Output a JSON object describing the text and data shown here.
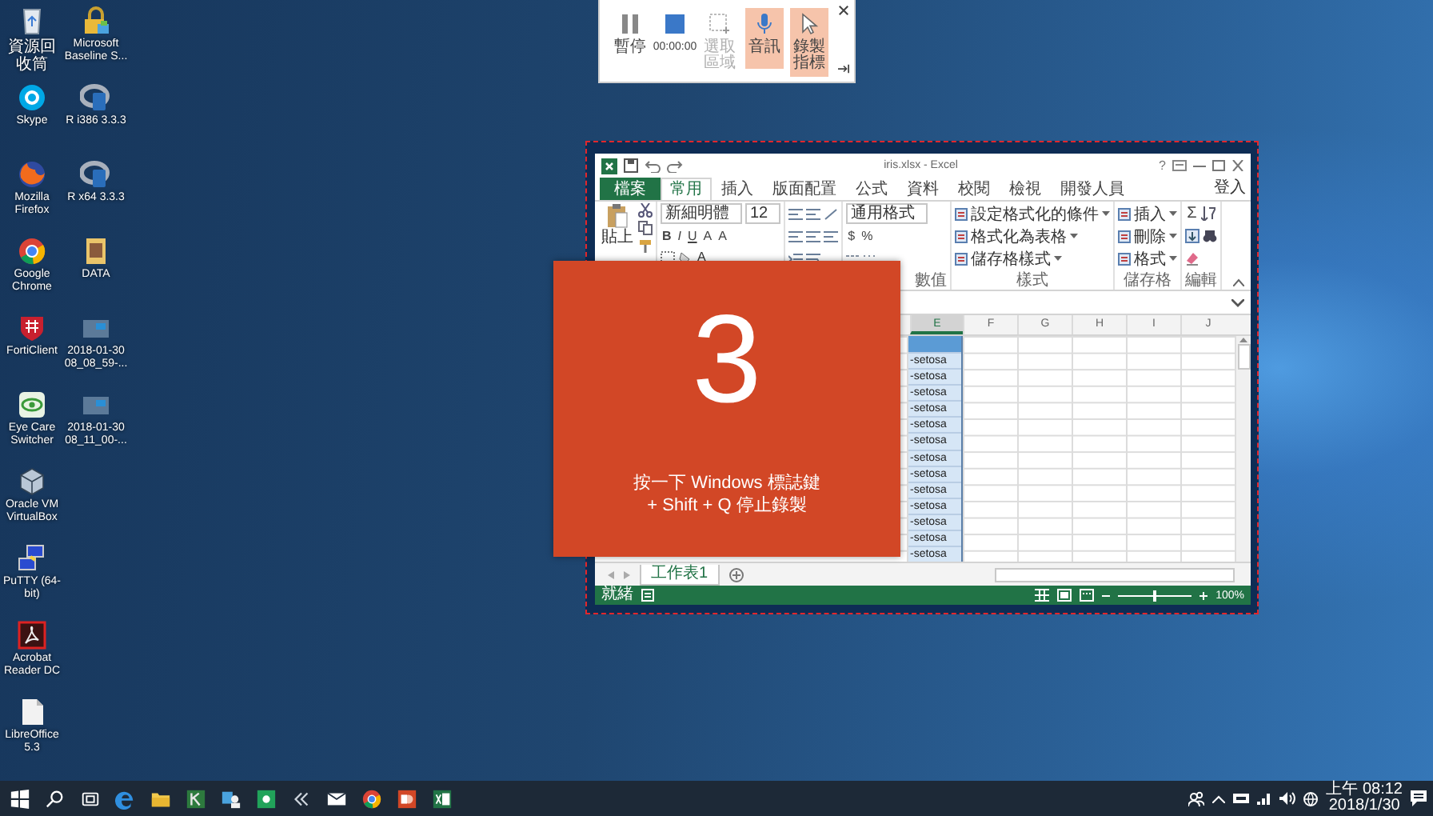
{
  "desktop_icons": [
    {
      "label": "資源回收筒",
      "kind": "recycle"
    },
    {
      "label": "Skype",
      "kind": "skype"
    },
    {
      "label": "Mozilla Firefox",
      "kind": "firefox"
    },
    {
      "label": "Google Chrome",
      "kind": "chrome"
    },
    {
      "label": "FortiClient",
      "kind": "forti"
    },
    {
      "label": "Eye Care Switcher",
      "kind": "eye"
    },
    {
      "label": "Oracle VM VirtualBox",
      "kind": "vbox"
    },
    {
      "label": "PuTTY (64-bit)",
      "kind": "putty"
    },
    {
      "label": "Acrobat Reader DC",
      "kind": "acrobat"
    },
    {
      "label": "LibreOffice 5.3",
      "kind": "doc"
    },
    {
      "label": "Microsoft Baseline S...",
      "kind": "lock"
    },
    {
      "label": "R i386 3.3.3",
      "kind": "r"
    },
    {
      "label": "R x64 3.3.3",
      "kind": "r"
    },
    {
      "label": "DATA",
      "kind": "folder"
    },
    {
      "label": "2018-01-30 08_08_59-...",
      "kind": "video"
    },
    {
      "label": "2018-01-30 08_11_00-...",
      "kind": "video"
    }
  ],
  "recorder": {
    "buttons": [
      {
        "kind": "pause",
        "label": "暫停",
        "selected": false,
        "disabled": false
      },
      {
        "kind": "stop",
        "label": "00:00:00",
        "selected": false,
        "disabled": false
      },
      {
        "kind": "region",
        "label": "選取區域",
        "selected": false,
        "disabled": true
      },
      {
        "kind": "audio",
        "label": "音訊",
        "selected": true,
        "disabled": false
      },
      {
        "kind": "pointer",
        "label": "錄製指標",
        "selected": true,
        "disabled": false
      }
    ]
  },
  "excel": {
    "title": "iris.xlsx - Excel",
    "help": "?",
    "tabs": [
      {
        "label": "檔案",
        "kind": "file",
        "selected": false
      },
      {
        "label": "常用",
        "kind": "tab",
        "selected": true
      },
      {
        "label": "插入",
        "kind": "tab",
        "selected": false
      },
      {
        "label": "版面配置",
        "kind": "tab",
        "selected": false
      },
      {
        "label": "公式",
        "kind": "tab",
        "selected": false
      },
      {
        "label": "資料",
        "kind": "tab",
        "selected": false
      },
      {
        "label": "校閱",
        "kind": "tab",
        "selected": false
      },
      {
        "label": "檢視",
        "kind": "tab",
        "selected": false
      },
      {
        "label": "開發人員",
        "kind": "tab",
        "selected": false
      }
    ],
    "sign_in": "登入",
    "ribbon": [
      {
        "kind": "clipboard",
        "button": "貼上"
      },
      {
        "kind": "font",
        "font_name": "新細明體",
        "font_size": "12",
        "toggles": [
          "B",
          "I",
          "U"
        ],
        "size_buttons": [
          "A",
          "A"
        ],
        "font_color": "A"
      },
      {
        "kind": "alignment"
      },
      {
        "kind": "number",
        "label": "數值",
        "format": "通用格式",
        "symbols": [
          "$",
          "%"
        ]
      },
      {
        "kind": "commands",
        "label": "樣式",
        "items": [
          "設定格式化的條件",
          "格式化為表格",
          "儲存格樣式"
        ]
      },
      {
        "kind": "commands",
        "label": "儲存格",
        "items": [
          "插入",
          "刪除",
          "格式"
        ]
      },
      {
        "kind": "editing",
        "label": "編輯",
        "autosum": "Σ"
      }
    ],
    "sheet": {
      "columns": [
        {
          "label": "E",
          "selected": true,
          "cells": [
            "-setosa",
            "-setosa",
            "-setosa",
            "-setosa",
            "-setosa",
            "-setosa",
            "-setosa",
            "-setosa",
            "-setosa",
            "-setosa",
            "-setosa",
            "-setosa",
            "-setosa"
          ]
        },
        {
          "label": "F",
          "selected": false
        },
        {
          "label": "G",
          "selected": false
        },
        {
          "label": "H",
          "selected": false
        },
        {
          "label": "I",
          "selected": false
        },
        {
          "label": "J",
          "selected": false
        }
      ]
    },
    "sheet_tabs": [
      {
        "label": "工作表1",
        "selected": true
      }
    ],
    "status": "就緒",
    "zoom": {
      "level": 0.5,
      "reading": "100%"
    }
  },
  "countdown": {
    "number": "3",
    "lines": [
      "按一下 Windows 標誌鍵",
      "+ Shift + Q 停止錄製"
    ]
  },
  "taskbar": {
    "apps": [
      {
        "kind": "start"
      },
      {
        "kind": "search"
      },
      {
        "kind": "taskview"
      },
      {
        "kind": "edge"
      },
      {
        "kind": "explorer"
      },
      {
        "kind": "tool"
      },
      {
        "kind": "people"
      },
      {
        "kind": "greenapp"
      },
      {
        "kind": "arrows"
      },
      {
        "kind": "mail"
      },
      {
        "kind": "chrome"
      },
      {
        "kind": "slides"
      },
      {
        "kind": "sheets"
      }
    ],
    "time": "上午 08:12",
    "date": "2018/1/30"
  }
}
